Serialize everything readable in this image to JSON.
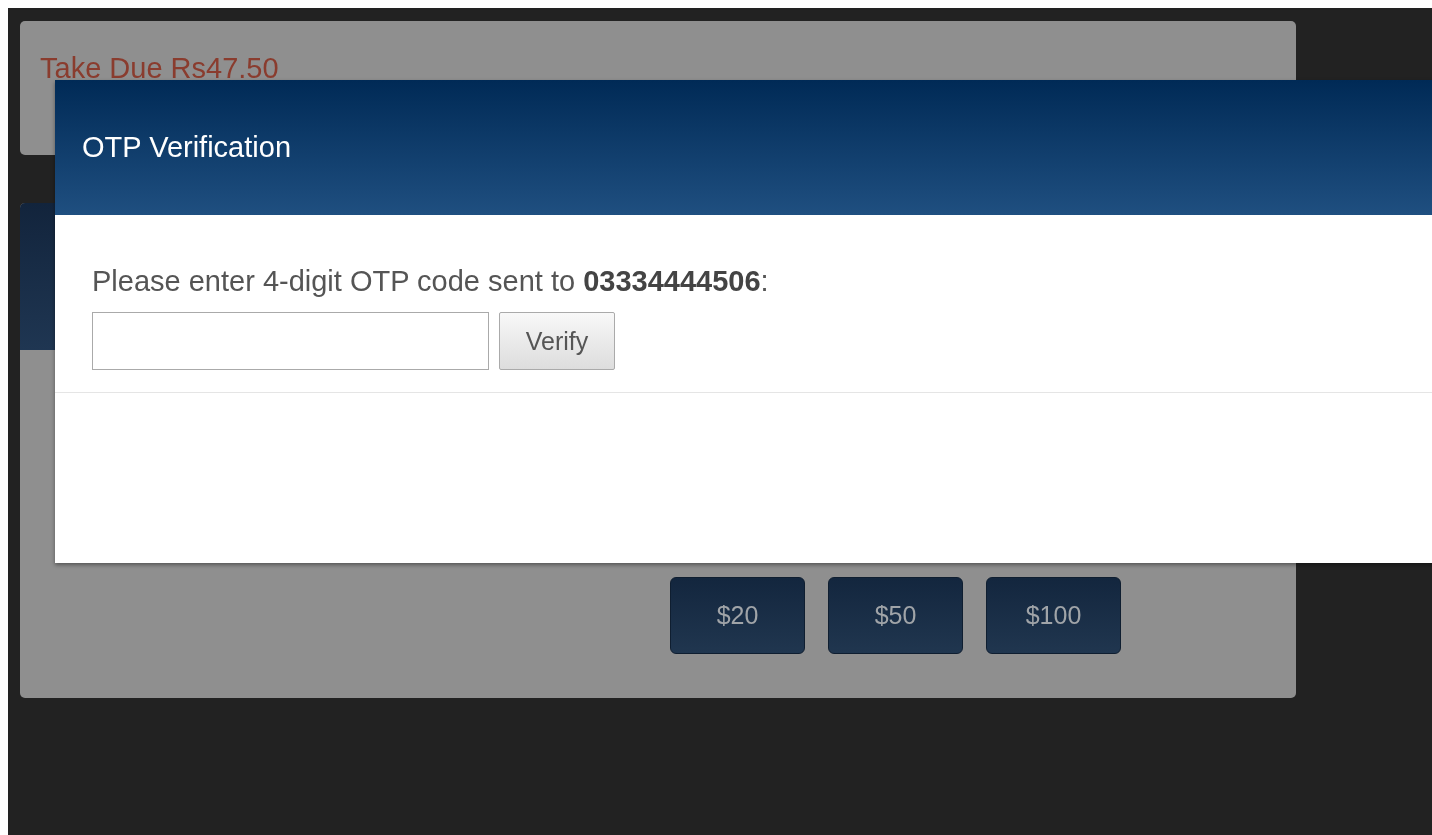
{
  "background": {
    "due_text": "Take Due Rs47.50",
    "amount_buttons": [
      "$20",
      "$50",
      "$100"
    ]
  },
  "modal": {
    "title": "OTP Verification",
    "prompt": "Please enter 4-digit OTP code sent to **03334444506**:",
    "verify_button": "Verify"
  }
}
